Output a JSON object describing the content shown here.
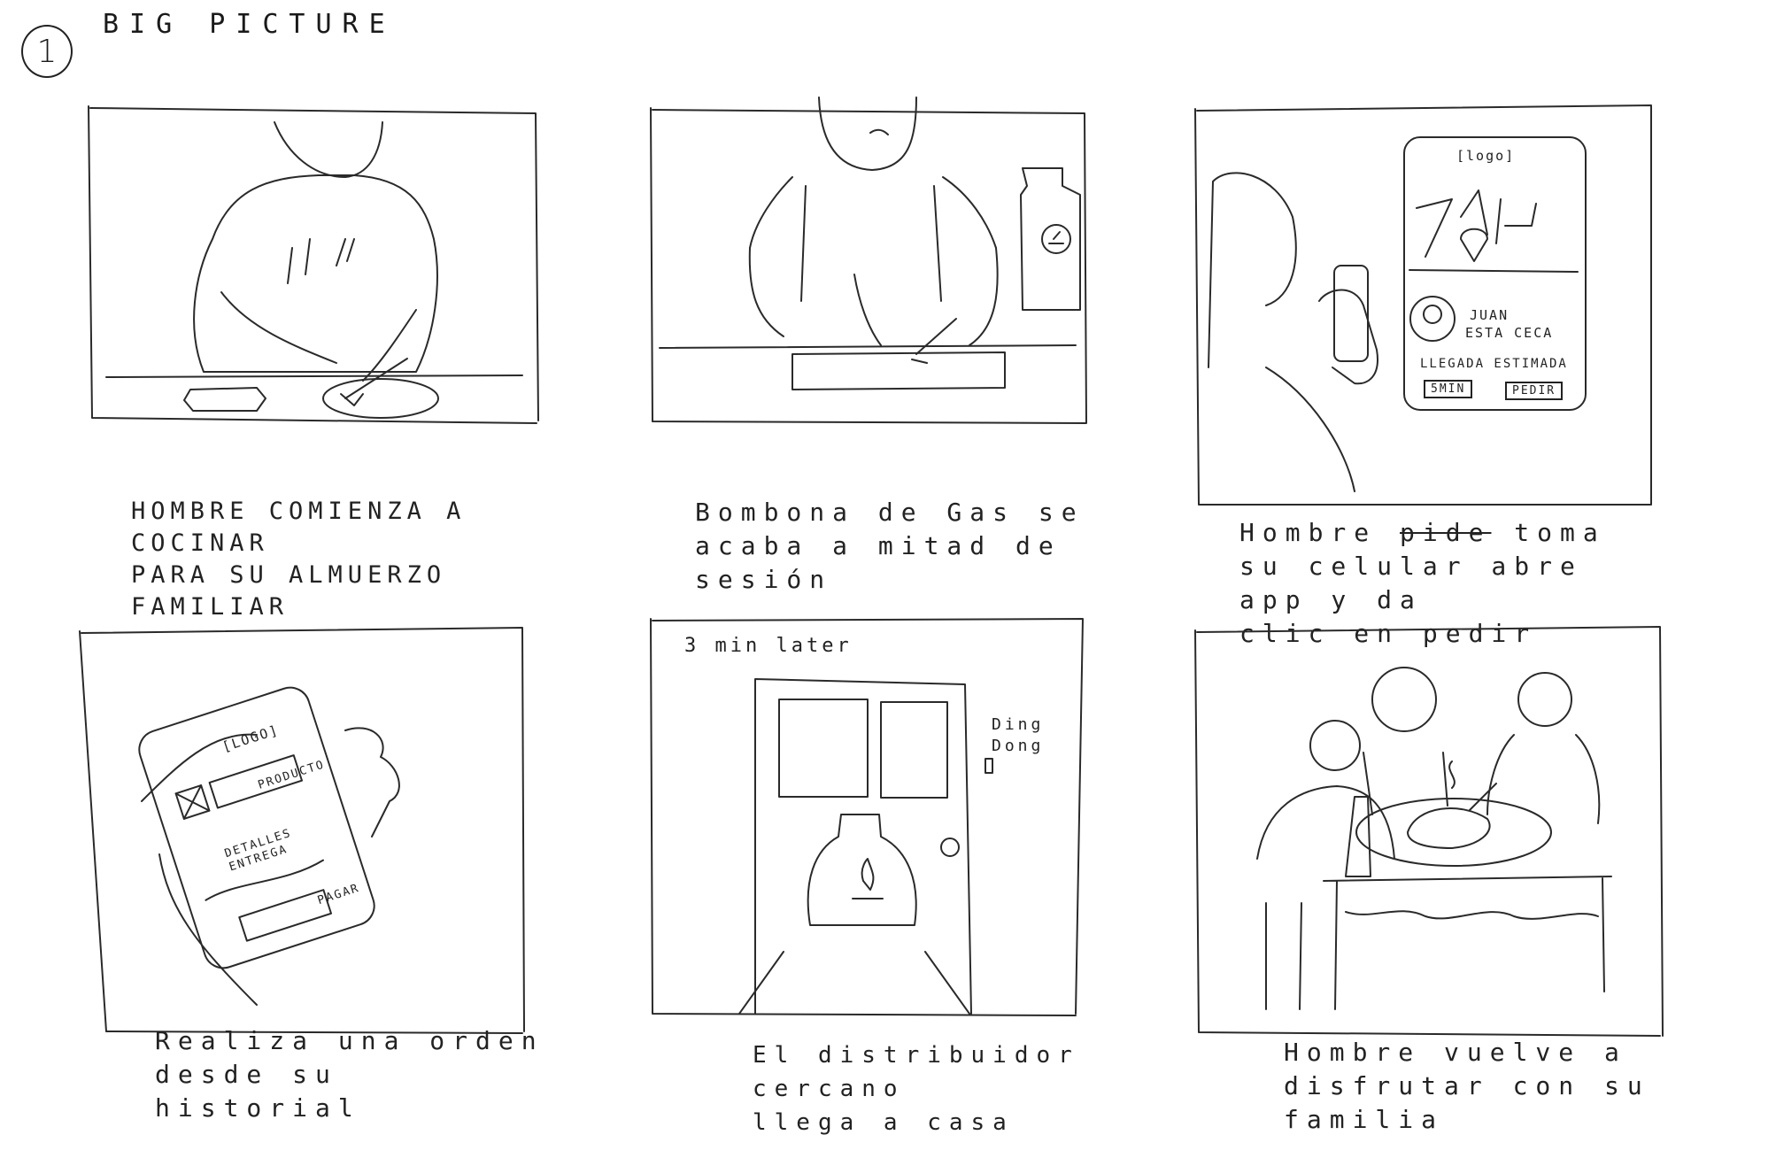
{
  "header": {
    "number": "1",
    "title": "BIG PICTURE"
  },
  "panels": [
    {
      "caption": "HOMBRE  COMIENZA A COCINAR\nPARA SU ALMUERZO FAMILIAR"
    },
    {
      "caption": "Bombona de Gas se\nacaba a mitad de\nsesión"
    },
    {
      "caption": "Hombre ~~pide~~ toma\nsu celular abre app y da\nclic en pedir",
      "caption_parts": {
        "before": "Hombre ",
        "struck": "pide",
        "after": " toma\nsu celular abre app y da\nclic en pedir"
      },
      "phone": {
        "logo": "[logo]",
        "user_line1": "JUAN",
        "user_line2": "ESTA CECA",
        "eta_label": "LLEGADA ESTIMADA",
        "eta_value": "5MIN",
        "order_button": "PEDIR"
      }
    },
    {
      "caption": "Realiza una orden\ndesde su historial",
      "phone": {
        "logo": "[LOGO]",
        "product": "PRODUCTO",
        "details": "DETALLES\nENTREGA",
        "pay_button": "PAGAR"
      }
    },
    {
      "note": "3 min later",
      "sound": "Ding\nDong",
      "caption": "El distribuidor cercano\nllega a casa"
    },
    {
      "caption": "Hombre vuelve a\ndisfrutar con su\nfamilia"
    }
  ]
}
